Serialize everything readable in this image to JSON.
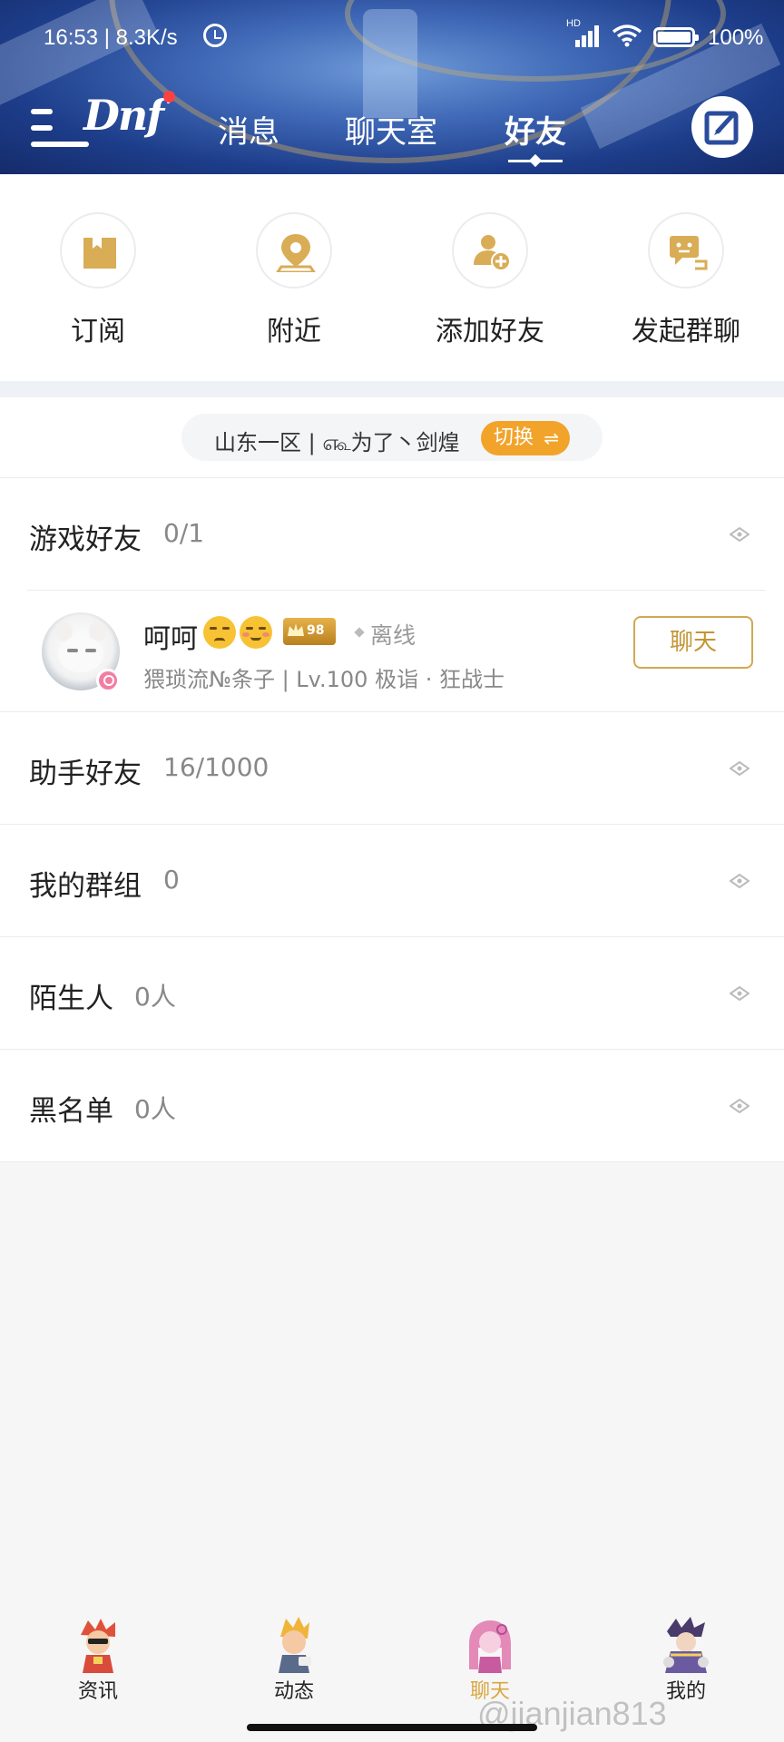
{
  "status_bar": {
    "time_speed": "16:53 | 8.3K/s",
    "network": "HD",
    "battery": "100%"
  },
  "header": {
    "logo": "Dnf",
    "tabs": [
      {
        "label": "消息",
        "active": false
      },
      {
        "label": "聊天室",
        "active": false
      },
      {
        "label": "好友",
        "active": true
      }
    ],
    "edit_icon": "edit-icon"
  },
  "quick_actions": [
    {
      "label": "订阅",
      "icon": "bookmark-icon"
    },
    {
      "label": "附近",
      "icon": "location-icon"
    },
    {
      "label": "添加好友",
      "icon": "add-friend-icon"
    },
    {
      "label": "发起群聊",
      "icon": "group-chat-icon"
    }
  ],
  "server": {
    "text": "山东一区 | ௷为了丶剑煌",
    "switch_label": "切换",
    "switch_icon": "⇌"
  },
  "sections": [
    {
      "title": "游戏好友",
      "count": "0/1"
    },
    {
      "title": "助手好友",
      "count": "16/1000"
    },
    {
      "title": "我的群组",
      "count": "0"
    },
    {
      "title": "陌生人",
      "count": "0人"
    },
    {
      "title": "黑名单",
      "count": "0人"
    }
  ],
  "friend": {
    "name": "呵呵",
    "vip_level": "98",
    "status": "离线",
    "info": "猥琐流№条子 | Lv.100 极诣 · 狂战士",
    "chat_button": "聊天"
  },
  "bottom_nav": [
    {
      "label": "资讯",
      "active": false
    },
    {
      "label": "动态",
      "active": false
    },
    {
      "label": "聊天",
      "active": true
    },
    {
      "label": "我的",
      "active": false
    }
  ],
  "watermark": "@jianjian813",
  "colors": {
    "accent_gold": "#d2a850",
    "switch_orange": "#f2a32a",
    "header_blue": "#2a4c9c"
  }
}
